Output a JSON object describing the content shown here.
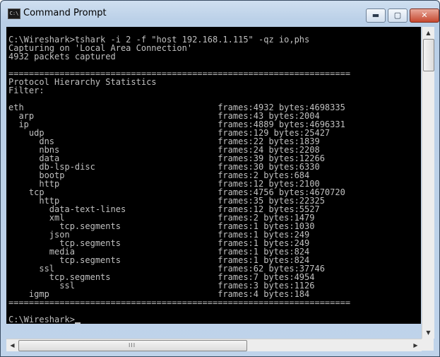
{
  "window": {
    "title": "Command Prompt",
    "icon": "cmd-icon",
    "buttons": {
      "minimize": "▬",
      "maximize": "▢",
      "close": "✕"
    }
  },
  "console": {
    "lines": [
      "",
      "C:\\Wireshark>tshark -i 2 -f \"host 192.168.1.115\" -qz io,phs",
      "Capturing on 'Local Area Connection'",
      "4932 packets captured",
      "",
      "===================================================================",
      "Protocol Hierarchy Statistics",
      "Filter:",
      "",
      "eth                                      frames:4932 bytes:4698335",
      "  arp                                    frames:43 bytes:2004",
      "  ip                                     frames:4889 bytes:4696331",
      "    udp                                  frames:129 bytes:25427",
      "      dns                                frames:22 bytes:1839",
      "      nbns                               frames:24 bytes:2208",
      "      data                               frames:39 bytes:12266",
      "      db-lsp-disc                        frames:30 bytes:6330",
      "      bootp                              frames:2 bytes:684",
      "      http                               frames:12 bytes:2100",
      "    tcp                                  frames:4756 bytes:4670720",
      "      http                               frames:35 bytes:22325",
      "        data-text-lines                  frames:12 bytes:5527",
      "        xml                              frames:2 bytes:1479",
      "          tcp.segments                   frames:1 bytes:1030",
      "        json                             frames:1 bytes:249",
      "          tcp.segments                   frames:1 bytes:249",
      "        media                            frames:1 bytes:824",
      "          tcp.segments                   frames:1 bytes:824",
      "      ssl                                frames:62 bytes:37746",
      "        tcp.segments                     frames:7 bytes:4954",
      "          ssl                            frames:3 bytes:1126",
      "    igmp                                 frames:4 bytes:184",
      "===================================================================",
      "",
      "C:\\Wireshark>"
    ]
  },
  "scrollbars": {
    "up": "▲",
    "down": "▼",
    "left": "◀",
    "right": "▶",
    "grip": "III"
  },
  "colors": {
    "console_bg": "#000000",
    "console_fg": "#c0c0c0",
    "close_button": "#c6482f"
  }
}
